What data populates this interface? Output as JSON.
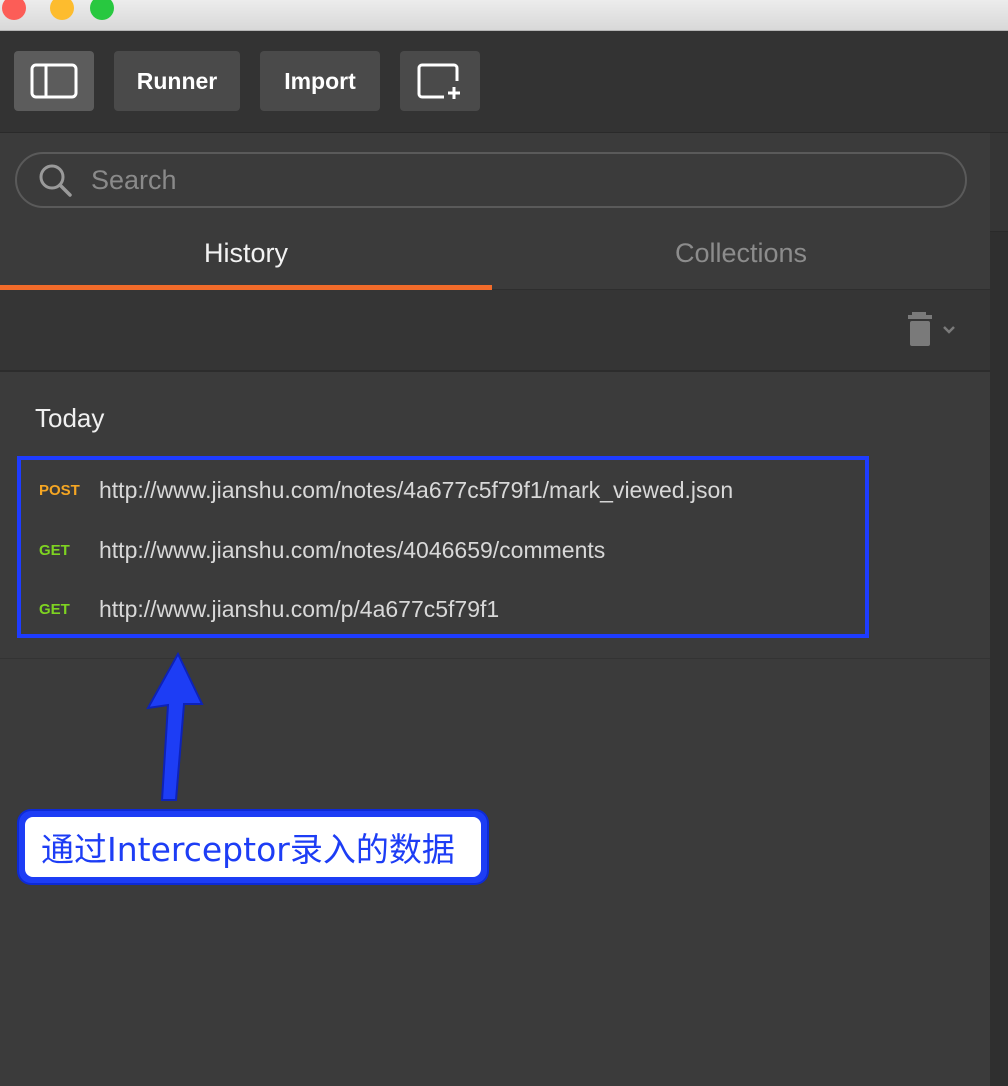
{
  "toolbar": {
    "sidebar_toggle": "sidebar-toggle-icon",
    "runner_label": "Runner",
    "import_label": "Import",
    "new_window": "new-window-icon"
  },
  "search": {
    "placeholder": "Search",
    "value": ""
  },
  "tabs": [
    {
      "label": "History",
      "active": true
    },
    {
      "label": "Collections",
      "active": false
    }
  ],
  "history": {
    "group_label": "Today",
    "items": [
      {
        "method": "POST",
        "url": "http://www.jianshu.com/notes/4a677c5f79f1/mark_viewed.json"
      },
      {
        "method": "GET",
        "url": "http://www.jianshu.com/notes/4046659/comments"
      },
      {
        "method": "GET",
        "url": "http://www.jianshu.com/p/4a677c5f79f1"
      }
    ]
  },
  "annotation": {
    "text": "通过Interceptor录入的数据"
  },
  "colors": {
    "accent_tab": "#f26b2a",
    "post": "#f5a623",
    "get": "#7ed321",
    "highlight": "#1d3df5"
  }
}
